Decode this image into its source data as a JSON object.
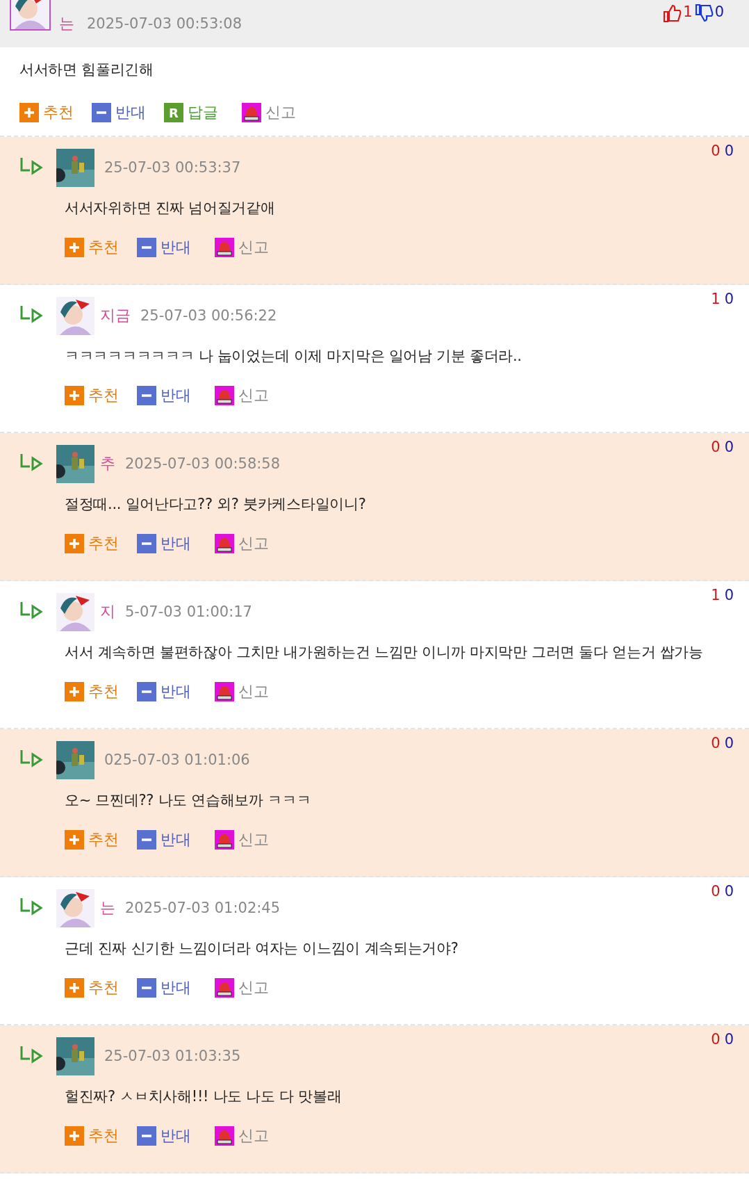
{
  "comments": [
    {
      "is_reply": false,
      "highlighted": false,
      "author": "는",
      "time": "2025-07-03 00:53:08",
      "likes": "1",
      "dislikes": "0",
      "text": "서서하면 힘풀리긴해",
      "actions": [
        {
          "kind": "recommend",
          "label": "추천"
        },
        {
          "kind": "oppose",
          "label": "반대"
        },
        {
          "kind": "reply",
          "badge": "R",
          "label": "답글"
        },
        {
          "kind": "report",
          "label": "신고"
        }
      ]
    },
    {
      "is_reply": true,
      "highlighted": true,
      "time": "25-07-03 00:53:37",
      "likes": "0",
      "dislikes": "0",
      "text": "서서자위하면 진짜 넘어질거같애",
      "actions": [
        {
          "kind": "recommend",
          "label": "추천"
        },
        {
          "kind": "oppose",
          "label": "반대"
        },
        {
          "kind": "report",
          "label": "신고"
        }
      ]
    },
    {
      "is_reply": true,
      "highlighted": false,
      "author": "지금",
      "time": "25-07-03 00:56:22",
      "likes": "1",
      "dislikes": "0",
      "text": "ㅋㅋㅋㅋㅋㅋㅋㅋㅋ 나 눕이었는데 이제 마지막은 일어남 기분 좋더라..",
      "actions": [
        {
          "kind": "recommend",
          "label": "추천"
        },
        {
          "kind": "oppose",
          "label": "반대"
        },
        {
          "kind": "report",
          "label": "신고"
        }
      ]
    },
    {
      "is_reply": true,
      "highlighted": true,
      "author": "추",
      "time": "2025-07-03 00:58:58",
      "likes": "0",
      "dislikes": "0",
      "text": "절정때... 일어난다고?? 외? 붓카케스타일이니?",
      "actions": [
        {
          "kind": "recommend",
          "label": "추천"
        },
        {
          "kind": "oppose",
          "label": "반대"
        },
        {
          "kind": "report",
          "label": "신고"
        }
      ]
    },
    {
      "is_reply": true,
      "highlighted": false,
      "author": "지",
      "time": "5-07-03 01:00:17",
      "likes": "1",
      "dislikes": "0",
      "text": "서서 계속하면 불편하잖아 그치만 내가원하는건 느낌만 이니까 마지막만 그러면 둘다 얻는거 쌉가능",
      "actions": [
        {
          "kind": "recommend",
          "label": "추천"
        },
        {
          "kind": "oppose",
          "label": "반대"
        },
        {
          "kind": "report",
          "label": "신고"
        }
      ]
    },
    {
      "is_reply": true,
      "highlighted": true,
      "time": "025-07-03 01:01:06",
      "likes": "0",
      "dislikes": "0",
      "text": "오~ 므찐데?? 나도 연습해보까 ㅋㅋㅋ",
      "actions": [
        {
          "kind": "recommend",
          "label": "추천"
        },
        {
          "kind": "oppose",
          "label": "반대"
        },
        {
          "kind": "report",
          "label": "신고"
        }
      ]
    },
    {
      "is_reply": true,
      "highlighted": false,
      "author": "는",
      "time": "2025-07-03 01:02:45",
      "likes": "0",
      "dislikes": "0",
      "text": "근데 진짜 신기한 느낌이더라 여자는 이느낌이 계속되는거야?",
      "actions": [
        {
          "kind": "recommend",
          "label": "추천"
        },
        {
          "kind": "oppose",
          "label": "반대"
        },
        {
          "kind": "report",
          "label": "신고"
        }
      ]
    },
    {
      "is_reply": true,
      "highlighted": true,
      "time": "25-07-03 01:03:35",
      "likes": "0",
      "dislikes": "0",
      "text": "헐진짜? ㅅㅂ치사해!!! 나도 나도 다 맛볼래",
      "actions": [
        {
          "kind": "recommend",
          "label": "추천"
        },
        {
          "kind": "oppose",
          "label": "반대"
        },
        {
          "kind": "report",
          "label": "신고"
        }
      ]
    }
  ]
}
